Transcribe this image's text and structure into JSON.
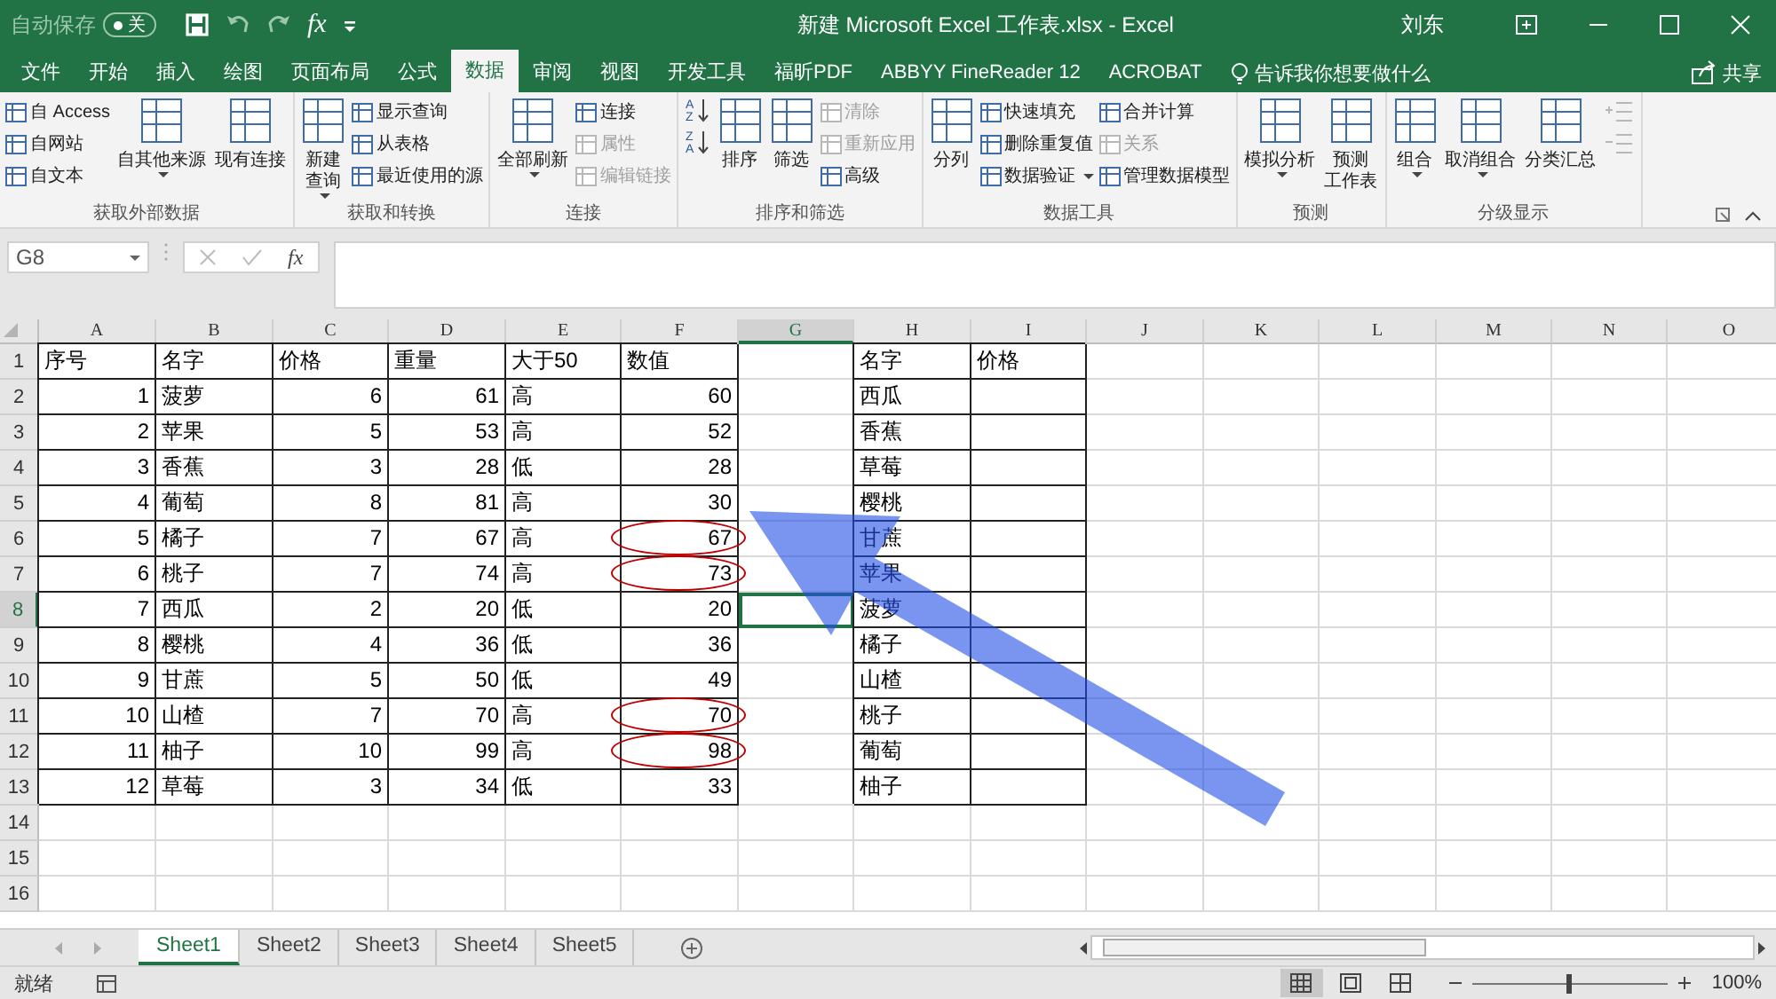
{
  "title_bar": {
    "autosave_label": "自动保存",
    "autosave_toggle": {
      "label": "关",
      "on": false
    },
    "formula_button": "fx",
    "title": "新建 Microsoft Excel 工作表.xlsx  -  Excel",
    "user": "刘东"
  },
  "tabs": [
    {
      "label": "文件",
      "selected": false
    },
    {
      "label": "开始",
      "selected": false
    },
    {
      "label": "插入",
      "selected": false
    },
    {
      "label": "绘图",
      "selected": false
    },
    {
      "label": "页面布局",
      "selected": false
    },
    {
      "label": "公式",
      "selected": false
    },
    {
      "label": "数据",
      "selected": true
    },
    {
      "label": "审阅",
      "selected": false
    },
    {
      "label": "视图",
      "selected": false
    },
    {
      "label": "开发工具",
      "selected": false
    },
    {
      "label": "福昕PDF",
      "selected": false
    },
    {
      "label": "ABBYY FineReader 12",
      "selected": false
    },
    {
      "label": "ACROBAT",
      "selected": false
    }
  ],
  "tell_me": "告诉我你想要做什么",
  "share": "共享",
  "ribbon": [
    {
      "label": "获取外部数据",
      "columns": [
        [
          {
            "kind": "small",
            "label": "自 Access",
            "disabled": false
          },
          {
            "kind": "small",
            "label": "自网站",
            "disabled": false
          },
          {
            "kind": "small",
            "label": "自文本",
            "disabled": false
          }
        ],
        [
          {
            "kind": "large-menu",
            "label": "自其他来源",
            "disabled": false
          }
        ],
        [
          {
            "kind": "large",
            "label": "现有连接",
            "disabled": false
          }
        ]
      ]
    },
    {
      "label": "获取和转换",
      "columns": [
        [
          {
            "kind": "large-menu",
            "label": [
              "新建",
              "查询"
            ],
            "disabled": false
          }
        ],
        [
          {
            "kind": "small",
            "label": "显示查询",
            "disabled": false
          },
          {
            "kind": "small",
            "label": "从表格",
            "disabled": false
          },
          {
            "kind": "small",
            "label": "最近使用的源",
            "disabled": false
          }
        ]
      ]
    },
    {
      "label": "连接",
      "columns": [
        [
          {
            "kind": "large-menu",
            "label": "全部刷新",
            "disabled": false
          }
        ],
        [
          {
            "kind": "small",
            "label": "连接",
            "disabled": false
          },
          {
            "kind": "small",
            "label": "属性",
            "disabled": true
          },
          {
            "kind": "small",
            "label": "编辑链接",
            "disabled": true
          }
        ]
      ]
    },
    {
      "label": "排序和筛选",
      "columns": [
        [
          {
            "kind": "sort-asc",
            "letters": [
              "A",
              "Z"
            ],
            "disabled": false
          },
          {
            "kind": "sort-desc",
            "letters": [
              "Z",
              "A"
            ],
            "disabled": false
          }
        ],
        [
          {
            "kind": "large",
            "label": "排序",
            "disabled": false
          }
        ],
        [
          {
            "kind": "large",
            "label": "筛选",
            "disabled": false
          }
        ],
        [
          {
            "kind": "small",
            "label": "清除",
            "disabled": true
          },
          {
            "kind": "small",
            "label": "重新应用",
            "disabled": true
          },
          {
            "kind": "small",
            "label": "高级",
            "disabled": false
          }
        ]
      ]
    },
    {
      "label": "数据工具",
      "columns": [
        [
          {
            "kind": "large",
            "label": "分列",
            "disabled": false
          }
        ],
        [
          {
            "kind": "small",
            "label": "快速填充",
            "disabled": false
          },
          {
            "kind": "small",
            "label": "删除重复值",
            "disabled": false
          },
          {
            "kind": "small-menu",
            "label": "数据验证",
            "disabled": false
          }
        ],
        [
          {
            "kind": "small",
            "label": "合并计算",
            "disabled": false
          },
          {
            "kind": "small",
            "label": "关系",
            "disabled": true
          },
          {
            "kind": "small",
            "label": "管理数据模型",
            "disabled": false
          }
        ]
      ]
    },
    {
      "label": "预测",
      "columns": [
        [
          {
            "kind": "large-menu",
            "label": "模拟分析",
            "disabled": false
          }
        ],
        [
          {
            "kind": "large",
            "label": [
              "预测",
              "工作表"
            ],
            "disabled": false
          }
        ]
      ]
    },
    {
      "label": "分级显示",
      "columns": [
        [
          {
            "kind": "large-menu",
            "label": "组合",
            "disabled": false
          }
        ],
        [
          {
            "kind": "large-menu",
            "label": "取消组合",
            "disabled": false
          }
        ],
        [
          {
            "kind": "large",
            "label": "分类汇总",
            "disabled": false
          }
        ],
        [
          {
            "kind": "show-detail",
            "disabled": true
          },
          {
            "kind": "hide-detail",
            "disabled": true
          }
        ]
      ]
    }
  ],
  "formula_bar": {
    "name_box": "G8",
    "fx": "fx"
  },
  "grid": {
    "columns": [
      {
        "label": "A",
        "numeric": true,
        "bordered": true,
        "selected": false
      },
      {
        "label": "B",
        "numeric": false,
        "bordered": true,
        "selected": false
      },
      {
        "label": "C",
        "numeric": true,
        "bordered": true,
        "selected": false
      },
      {
        "label": "D",
        "numeric": true,
        "bordered": true,
        "selected": false
      },
      {
        "label": "E",
        "numeric": false,
        "bordered": true,
        "selected": false
      },
      {
        "label": "F",
        "numeric": true,
        "bordered": true,
        "selected": false
      },
      {
        "label": "G",
        "numeric": false,
        "bordered": false,
        "selected": true
      },
      {
        "label": "H",
        "numeric": false,
        "bordered": true,
        "selected": false
      },
      {
        "label": "I",
        "numeric": false,
        "bordered": true,
        "selected": false
      },
      {
        "label": "J",
        "numeric": false,
        "bordered": false,
        "selected": false
      },
      {
        "label": "K",
        "numeric": false,
        "bordered": false,
        "selected": false
      },
      {
        "label": "L",
        "numeric": false,
        "bordered": false,
        "selected": false
      },
      {
        "label": "M",
        "numeric": false,
        "bordered": false,
        "selected": false
      },
      {
        "label": "N",
        "numeric": false,
        "bordered": false,
        "selected": false
      },
      {
        "label": "O",
        "numeric": false,
        "bordered": false,
        "selected": false
      }
    ],
    "rows": [
      {
        "number": "1",
        "kind": "header",
        "selected": false,
        "circled": false,
        "cells": [
          "序号",
          "名字",
          "价格",
          "重量",
          "大于50",
          "数值",
          "",
          "名字",
          "价格"
        ]
      },
      {
        "number": "2",
        "kind": "data",
        "selected": false,
        "circled": false,
        "cells": [
          "1",
          "菠萝",
          "6",
          "61",
          "高",
          "60",
          "",
          "西瓜",
          ""
        ]
      },
      {
        "number": "3",
        "kind": "data",
        "selected": false,
        "circled": false,
        "cells": [
          "2",
          "苹果",
          "5",
          "53",
          "高",
          "52",
          "",
          "香蕉",
          ""
        ]
      },
      {
        "number": "4",
        "kind": "data",
        "selected": false,
        "circled": false,
        "cells": [
          "3",
          "香蕉",
          "3",
          "28",
          "低",
          "28",
          "",
          "草莓",
          ""
        ]
      },
      {
        "number": "5",
        "kind": "data",
        "selected": false,
        "circled": false,
        "cells": [
          "4",
          "葡萄",
          "8",
          "81",
          "高",
          "30",
          "",
          "樱桃",
          ""
        ]
      },
      {
        "number": "6",
        "kind": "data",
        "selected": false,
        "circled": true,
        "cells": [
          "5",
          "橘子",
          "7",
          "67",
          "高",
          "67",
          "",
          "甘蔗",
          ""
        ]
      },
      {
        "number": "7",
        "kind": "data",
        "selected": false,
        "circled": true,
        "cells": [
          "6",
          "桃子",
          "7",
          "74",
          "高",
          "73",
          "",
          "苹果",
          ""
        ]
      },
      {
        "number": "8",
        "kind": "data",
        "selected": true,
        "circled": false,
        "cells": [
          "7",
          "西瓜",
          "2",
          "20",
          "低",
          "20",
          "",
          "菠萝",
          ""
        ]
      },
      {
        "number": "9",
        "kind": "data",
        "selected": false,
        "circled": false,
        "cells": [
          "8",
          "樱桃",
          "4",
          "36",
          "低",
          "36",
          "",
          "橘子",
          ""
        ]
      },
      {
        "number": "10",
        "kind": "data",
        "selected": false,
        "circled": false,
        "cells": [
          "9",
          "甘蔗",
          "5",
          "50",
          "低",
          "49",
          "",
          "山楂",
          ""
        ]
      },
      {
        "number": "11",
        "kind": "data",
        "selected": false,
        "circled": true,
        "cells": [
          "10",
          "山楂",
          "7",
          "70",
          "高",
          "70",
          "",
          "桃子",
          ""
        ]
      },
      {
        "number": "12",
        "kind": "data",
        "selected": false,
        "circled": true,
        "cells": [
          "11",
          "柚子",
          "10",
          "99",
          "高",
          "98",
          "",
          "葡萄",
          ""
        ]
      },
      {
        "number": "13",
        "kind": "data",
        "selected": false,
        "circled": false,
        "cells": [
          "12",
          "草莓",
          "3",
          "34",
          "低",
          "33",
          "",
          "柚子",
          ""
        ]
      },
      {
        "number": "14",
        "kind": "empty",
        "selected": false,
        "circled": false
      },
      {
        "number": "15",
        "kind": "empty",
        "selected": false,
        "circled": false
      },
      {
        "number": "16",
        "kind": "empty",
        "selected": false,
        "circled": false
      }
    ]
  },
  "sheets": [
    {
      "label": "Sheet1",
      "selected": true
    },
    {
      "label": "Sheet2",
      "selected": false
    },
    {
      "label": "Sheet3",
      "selected": false
    },
    {
      "label": "Sheet4",
      "selected": false
    },
    {
      "label": "Sheet5",
      "selected": false
    }
  ],
  "status_bar": {
    "status": "就绪",
    "views": [
      {
        "kind": "normal",
        "selected": true
      },
      {
        "kind": "page-layout",
        "selected": false
      },
      {
        "kind": "page-break",
        "selected": false
      }
    ],
    "zoom": {
      "level": 0.5,
      "reading": "100%"
    }
  }
}
